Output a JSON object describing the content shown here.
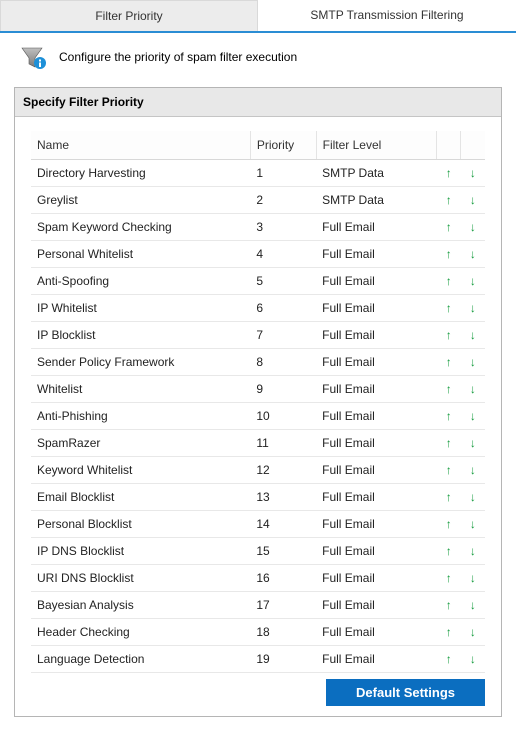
{
  "tabs": [
    {
      "label": "Filter Priority",
      "active": true
    },
    {
      "label": "SMTP Transmission Filtering",
      "active": false
    }
  ],
  "description": "Configure the priority of spam filter execution",
  "panel": {
    "title": "Specify Filter Priority",
    "columns": {
      "name": "Name",
      "priority": "Priority",
      "level": "Filter Level"
    },
    "rows": [
      {
        "name": "Directory Harvesting",
        "priority": "1",
        "level": "SMTP Data"
      },
      {
        "name": "Greylist",
        "priority": "2",
        "level": "SMTP Data"
      },
      {
        "name": "Spam Keyword Checking",
        "priority": "3",
        "level": "Full Email"
      },
      {
        "name": "Personal Whitelist",
        "priority": "4",
        "level": "Full Email"
      },
      {
        "name": "Anti-Spoofing",
        "priority": "5",
        "level": "Full Email"
      },
      {
        "name": "IP Whitelist",
        "priority": "6",
        "level": "Full Email"
      },
      {
        "name": "IP Blocklist",
        "priority": "7",
        "level": "Full Email"
      },
      {
        "name": "Sender Policy Framework",
        "priority": "8",
        "level": "Full Email"
      },
      {
        "name": "Whitelist",
        "priority": "9",
        "level": "Full Email"
      },
      {
        "name": "Anti-Phishing",
        "priority": "10",
        "level": "Full Email"
      },
      {
        "name": "SpamRazer",
        "priority": "11",
        "level": "Full Email"
      },
      {
        "name": "Keyword Whitelist",
        "priority": "12",
        "level": "Full Email"
      },
      {
        "name": "Email Blocklist",
        "priority": "13",
        "level": "Full Email"
      },
      {
        "name": "Personal Blocklist",
        "priority": "14",
        "level": "Full Email"
      },
      {
        "name": "IP DNS Blocklist",
        "priority": "15",
        "level": "Full Email"
      },
      {
        "name": "URI DNS Blocklist",
        "priority": "16",
        "level": "Full Email"
      },
      {
        "name": "Bayesian Analysis",
        "priority": "17",
        "level": "Full Email"
      },
      {
        "name": "Header Checking",
        "priority": "18",
        "level": "Full Email"
      },
      {
        "name": "Language Detection",
        "priority": "19",
        "level": "Full Email"
      }
    ],
    "default_button": "Default Settings"
  },
  "icons": {
    "funnel": "funnel-info-icon"
  },
  "colors": {
    "accent": "#2a8dd4",
    "arrow": "#149b3d",
    "button": "#0b6ec0"
  }
}
